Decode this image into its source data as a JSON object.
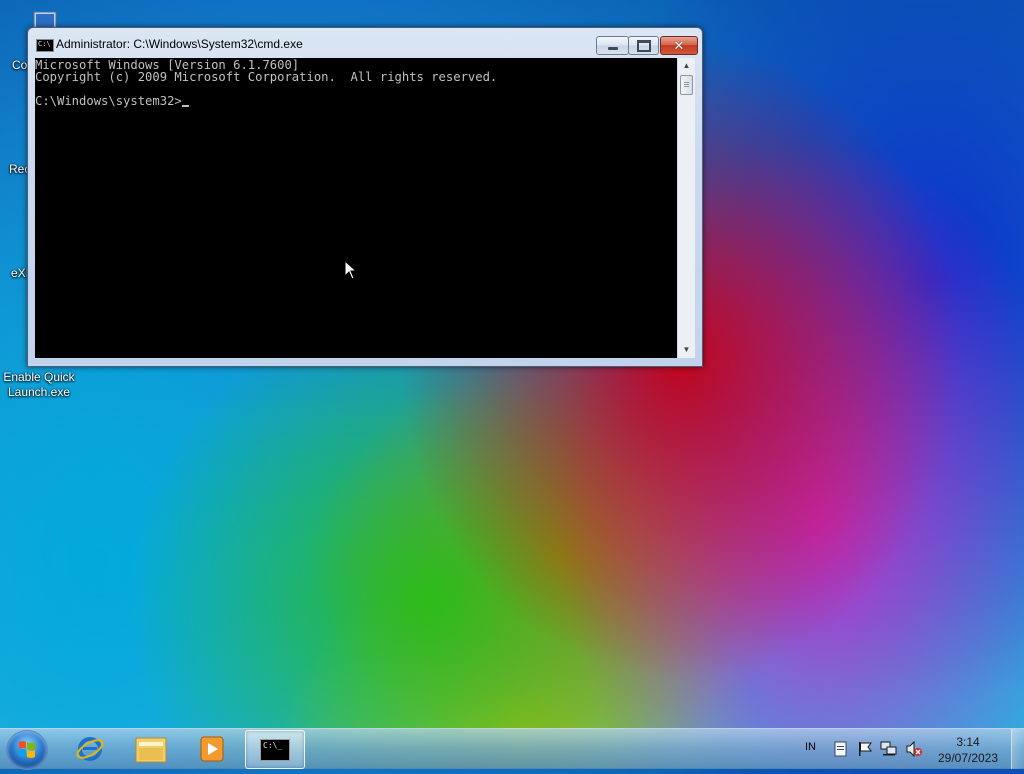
{
  "desktop": {
    "icons": [
      {
        "label": "Co",
        "icon": "computer-icon"
      },
      {
        "label": "Rec",
        "icon": "recycle-bin-icon"
      },
      {
        "label": "eXI",
        "icon": "folder-icon"
      },
      {
        "label": "Enable Quick Launch.exe",
        "icon": "shortcut-exe-icon"
      }
    ]
  },
  "window": {
    "title": "Administrator: C:\\Windows\\System32\\cmd.exe",
    "icon": "cmd-icon",
    "title_icon_text": "C:\\",
    "console_lines": [
      "Microsoft Windows [Version 6.1.7600]",
      "Copyright (c) 2009 Microsoft Corporation.  All rights reserved.",
      "",
      "C:\\Windows\\system32>"
    ],
    "buttons": {
      "minimize": "minimize",
      "maximize": "maximize",
      "close": "close"
    }
  },
  "taskbar": {
    "pinned": [
      {
        "name": "internet-explorer",
        "icon": "internet-explorer-icon"
      },
      {
        "name": "windows-explorer",
        "icon": "folder-icon"
      },
      {
        "name": "media-player",
        "icon": "media-player-icon"
      },
      {
        "name": "command-prompt",
        "icon": "cmd-icon",
        "active": true
      }
    ],
    "cmd_icon_text": "C:\\_",
    "tray": {
      "language": "IN",
      "icons": [
        "action-center-flag-icon",
        "network-icon",
        "volume-muted-icon"
      ]
    },
    "clock": {
      "time": "3:14",
      "date": "29/07/2023"
    }
  },
  "colors": {
    "console_bg": "#000000",
    "console_fg": "#c0c0c0",
    "close_button": "#c23a20"
  }
}
